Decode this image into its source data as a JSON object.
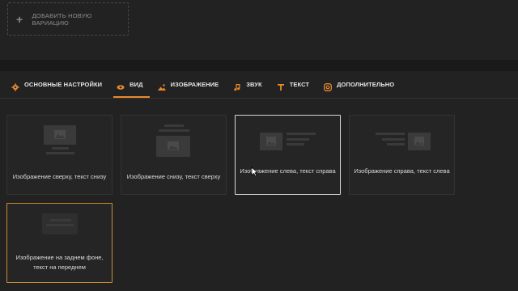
{
  "add_variation": {
    "label": "ДОБАВИТЬ НОВУЮ ВАРИАЦИЮ"
  },
  "tabs": [
    {
      "label": "ОСНОВНЫЕ НАСТРОЙКИ",
      "icon": "gear-icon"
    },
    {
      "label": "ВИД",
      "icon": "eye-icon"
    },
    {
      "label": "ИЗОБРАЖЕНИЕ",
      "icon": "image-icon"
    },
    {
      "label": "ЗВУК",
      "icon": "music-note-icon"
    },
    {
      "label": "ТЕКСТ",
      "icon": "text-t-icon"
    },
    {
      "label": "ДОПОЛНИТЕЛЬНО",
      "icon": "circle-settings-icon"
    }
  ],
  "active_tab": "ВИД",
  "cards": [
    {
      "label": "Изображение сверху, текст снизу"
    },
    {
      "label": "Изображение снизу, текст сверху"
    },
    {
      "label": "Изображение слева, текст справа"
    },
    {
      "label": "Изображение справа, текст слева"
    },
    {
      "label": "Изображение на заднем фоне, текст на переднем"
    }
  ],
  "colors": {
    "accent": "#e8892b",
    "background": "#222222"
  }
}
